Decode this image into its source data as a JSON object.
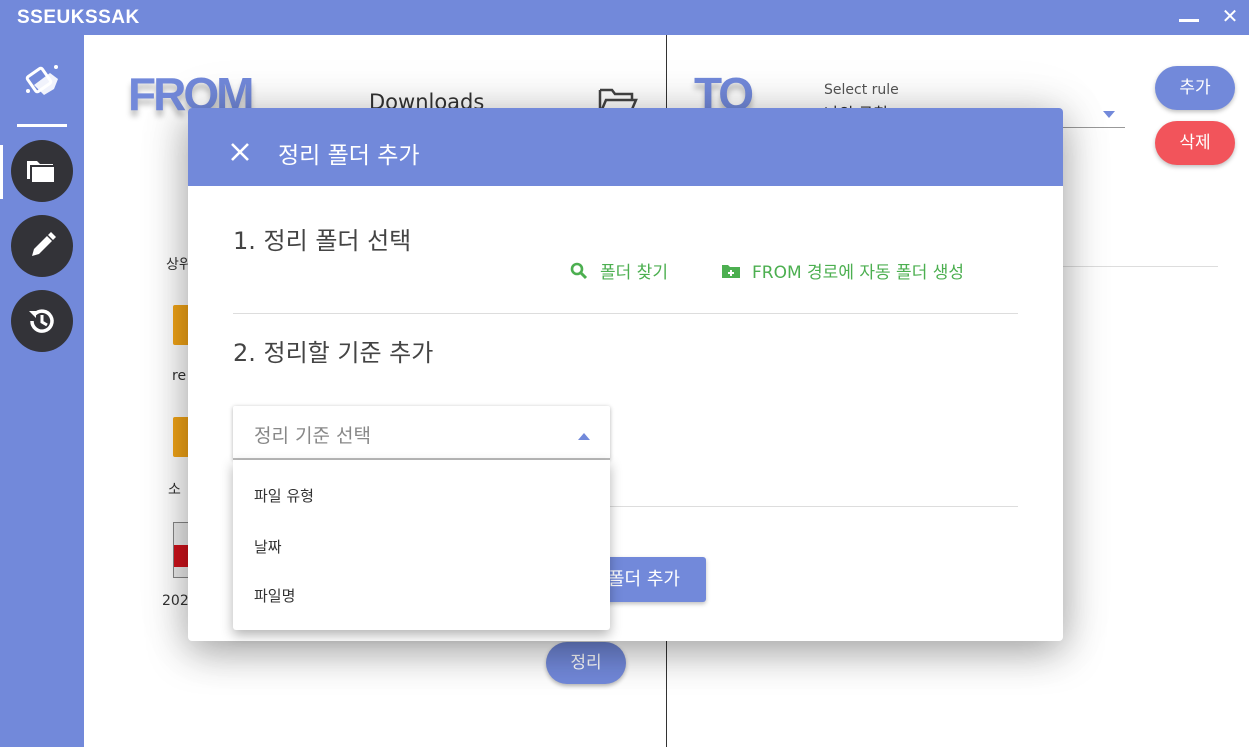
{
  "app": {
    "title": "SSEUKSSAK"
  },
  "window": {
    "minimize_icon": "minimize-icon",
    "close_icon": "close-icon"
  },
  "sidebar": {
    "items": [
      {
        "icon": "folders-icon",
        "active": true
      },
      {
        "icon": "pencil-icon",
        "active": false
      },
      {
        "icon": "history-icon",
        "active": false
      }
    ]
  },
  "from_panel": {
    "title": "FROM",
    "folder_name": "Downloads",
    "files": [
      "상위",
      "re",
      "소",
      "202"
    ],
    "organize_label": "정리"
  },
  "to_panel": {
    "title": "TO",
    "rule_label": "Select rule",
    "rule_value": "나의 규칙",
    "add_label": "추가",
    "delete_label": "삭제"
  },
  "dialog": {
    "title": "정리 폴더 추가",
    "section1": "1. 정리 폴더 선택",
    "find_folder": "폴더 찾기",
    "auto_create": "FROM 경로에 자동 폴더 생성",
    "section2": "2. 정리할 기준 추가",
    "select_placeholder": "정리 기준 선택",
    "options": [
      "파일 유형",
      "날짜",
      "파일명"
    ],
    "submit_label": "폴더 추가"
  },
  "colors": {
    "accent": "#7289da",
    "danger": "#f2545b",
    "success": "#4caf50",
    "dark": "#333338"
  }
}
